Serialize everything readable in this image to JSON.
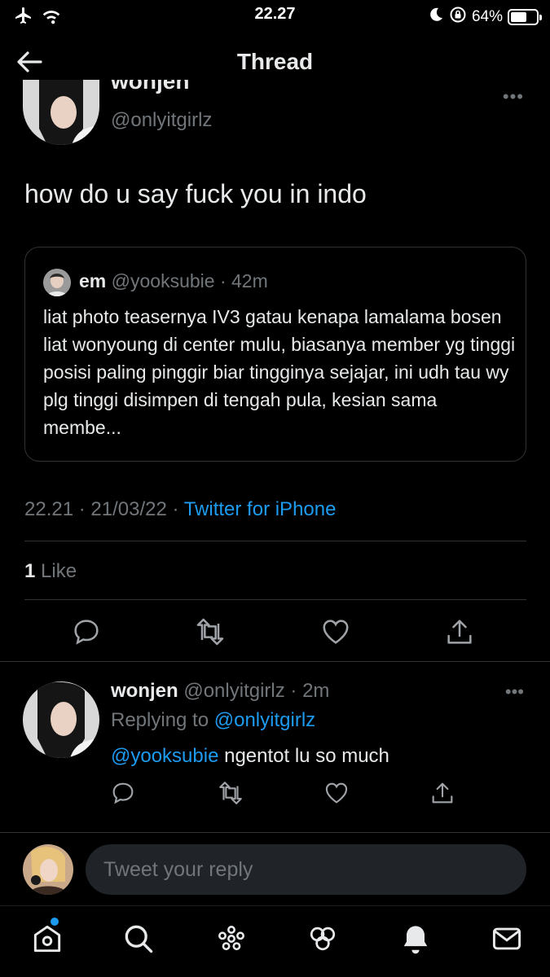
{
  "status_bar": {
    "time": "22.27",
    "battery_text": "64%",
    "battery_level": 0.64
  },
  "header": {
    "title": "Thread"
  },
  "main_tweet": {
    "display_name": "wonjen",
    "handle": "@onlyitgirlz",
    "text": "how do u say fuck you in indo",
    "quote": {
      "name": "em",
      "handle": "@yooksubie",
      "age": "· 42m",
      "text": "liat photo teasernya IV3 gatau kenapa lamalama bosen liat wonyoung di center mulu, biasanya member yg tinggi posisi paling pinggir biar tingginya sejajar, ini udh tau wy plg tinggi disimpen di tengah pula, kesian sama membe..."
    },
    "timestamp": "22.21 · 21/03/22 ·",
    "source": "Twitter for iPhone",
    "like_count": "1",
    "like_label": "Like"
  },
  "reply_tweet": {
    "display_name": "wonjen",
    "handle": "@onlyitgirlz",
    "age": "· 2m",
    "replying_label": "Replying to",
    "replying_handle": "@onlyitgirlz",
    "mention": "@yooksubie",
    "text": " ngentot lu so much"
  },
  "composer": {
    "placeholder": "Tweet your reply"
  },
  "colors": {
    "background": "#000000",
    "text": "#e7e9ea",
    "secondary": "#71767b",
    "accent": "#1d9bf0",
    "divider": "#2f3336"
  },
  "icons": {
    "status_left": [
      "airplane-icon",
      "wifi-icon"
    ],
    "status_right": [
      "moon-icon",
      "rotation-lock-icon",
      "battery-icon"
    ],
    "actions": [
      "reply-icon",
      "retweet-icon",
      "like-icon",
      "share-icon"
    ],
    "tabs": [
      "home-icon",
      "search-icon",
      "spaces-icon",
      "communities-icon",
      "notifications-icon",
      "messages-icon"
    ]
  }
}
